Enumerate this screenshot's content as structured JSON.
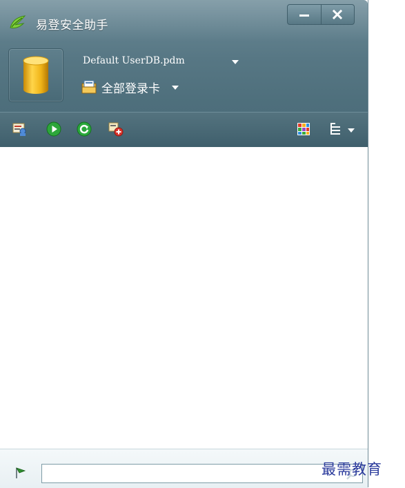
{
  "window": {
    "title": "易登安全助手"
  },
  "database": {
    "name": "Default UserDB.pdm"
  },
  "card_selector": {
    "label": "全部登录卡"
  },
  "toolbar": {
    "left_icons": [
      "user-card-icon",
      "play-icon",
      "refresh-icon",
      "add-card-icon"
    ],
    "right_icons": [
      "view-grid-icon",
      "sort-list-icon"
    ]
  },
  "footer": {
    "search_value": ""
  },
  "watermark": "最需教育",
  "colors": {
    "header": "#577784",
    "toolbar": "#4a6a78",
    "accent_green": "#1f9b2f",
    "watermark": "#2a3a9c"
  }
}
